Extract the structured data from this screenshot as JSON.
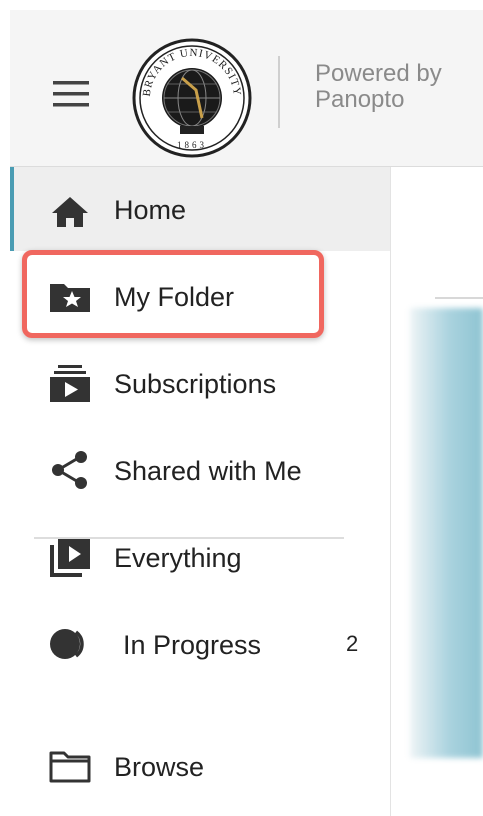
{
  "header": {
    "powered_line1": "Powered by",
    "powered_line2": "Panopto",
    "logo": {
      "top_text": "BRYANT UNIVERSITY",
      "year": "1863"
    }
  },
  "sidebar": {
    "items": [
      {
        "label": "Home",
        "icon": "home-icon",
        "active": true
      },
      {
        "label": "My Folder",
        "icon": "folder-star-icon"
      },
      {
        "label": "Subscriptions",
        "icon": "subscriptions-icon"
      },
      {
        "label": "Shared with Me",
        "icon": "share-icon"
      },
      {
        "label": "Everything",
        "icon": "video-library-icon"
      },
      {
        "label": "In Progress",
        "icon": "in-progress-icon",
        "count": "2"
      },
      {
        "label": "Browse",
        "icon": "folder-outline-icon"
      }
    ]
  },
  "colors": {
    "accent": "#4a9cb3",
    "highlight": "#f0675f"
  }
}
